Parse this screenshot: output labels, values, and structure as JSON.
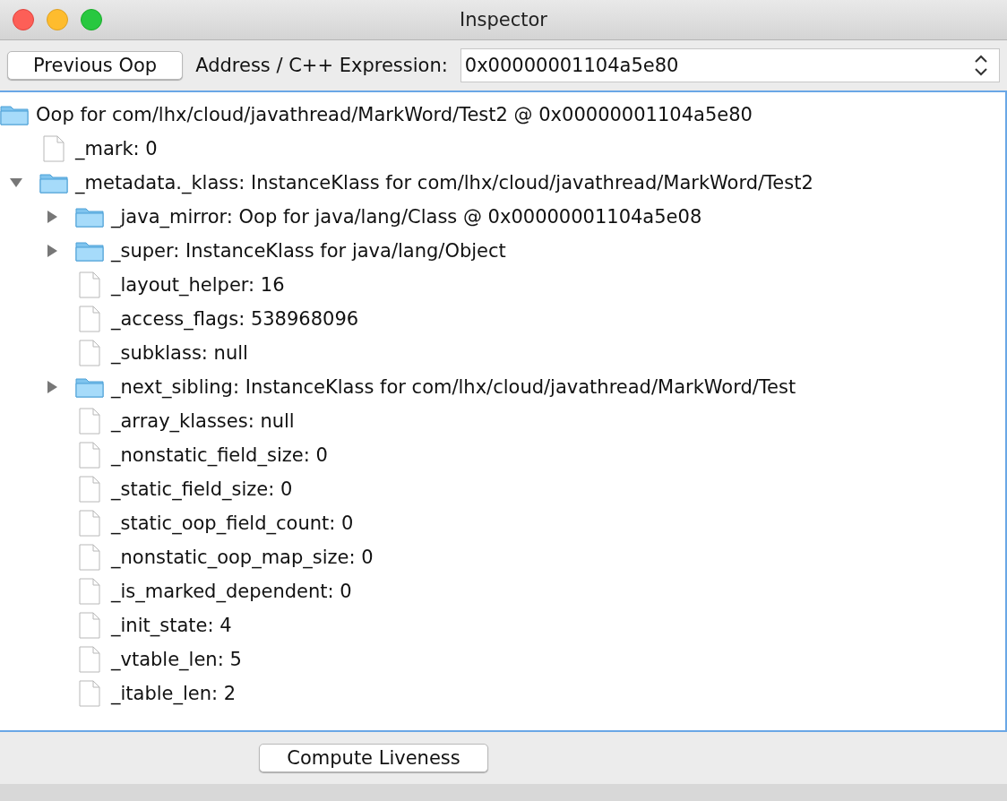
{
  "window": {
    "title": "Inspector"
  },
  "toolbar": {
    "previous_button": "Previous Oop",
    "address_label": "Address / C++ Expression:",
    "address_value": "0x00000001104a5e80"
  },
  "tree": {
    "label": "Oop for com/lhx/cloud/javathread/MarkWord/Test2 @ 0x00000001104a5e80",
    "kind": "folder",
    "children": [
      {
        "label": "_mark: 0",
        "kind": "leaf"
      },
      {
        "label": "_metadata._klass: InstanceKlass for com/lhx/cloud/javathread/MarkWord/Test2",
        "kind": "folder",
        "expanded": true,
        "children": [
          {
            "label": "_java_mirror: Oop for java/lang/Class @ 0x00000001104a5e08",
            "kind": "folder",
            "expanded": false
          },
          {
            "label": "_super: InstanceKlass for java/lang/Object",
            "kind": "folder",
            "expanded": false
          },
          {
            "label": "_layout_helper: 16",
            "kind": "leaf"
          },
          {
            "label": "_access_flags: 538968096",
            "kind": "leaf"
          },
          {
            "label": "_subklass: null",
            "kind": "leaf"
          },
          {
            "label": "_next_sibling: InstanceKlass for com/lhx/cloud/javathread/MarkWord/Test",
            "kind": "folder",
            "expanded": false
          },
          {
            "label": "_array_klasses: null",
            "kind": "leaf"
          },
          {
            "label": "_nonstatic_field_size: 0",
            "kind": "leaf"
          },
          {
            "label": "_static_field_size: 0",
            "kind": "leaf"
          },
          {
            "label": "_static_oop_field_count: 0",
            "kind": "leaf"
          },
          {
            "label": "_nonstatic_oop_map_size: 0",
            "kind": "leaf"
          },
          {
            "label": "_is_marked_dependent: 0",
            "kind": "leaf"
          },
          {
            "label": "_init_state: 4",
            "kind": "leaf"
          },
          {
            "label": "_vtable_len: 5",
            "kind": "leaf"
          },
          {
            "label": "_itable_len: 2",
            "kind": "leaf"
          }
        ]
      }
    ]
  },
  "bottom": {
    "button": "Compute Liveness"
  }
}
